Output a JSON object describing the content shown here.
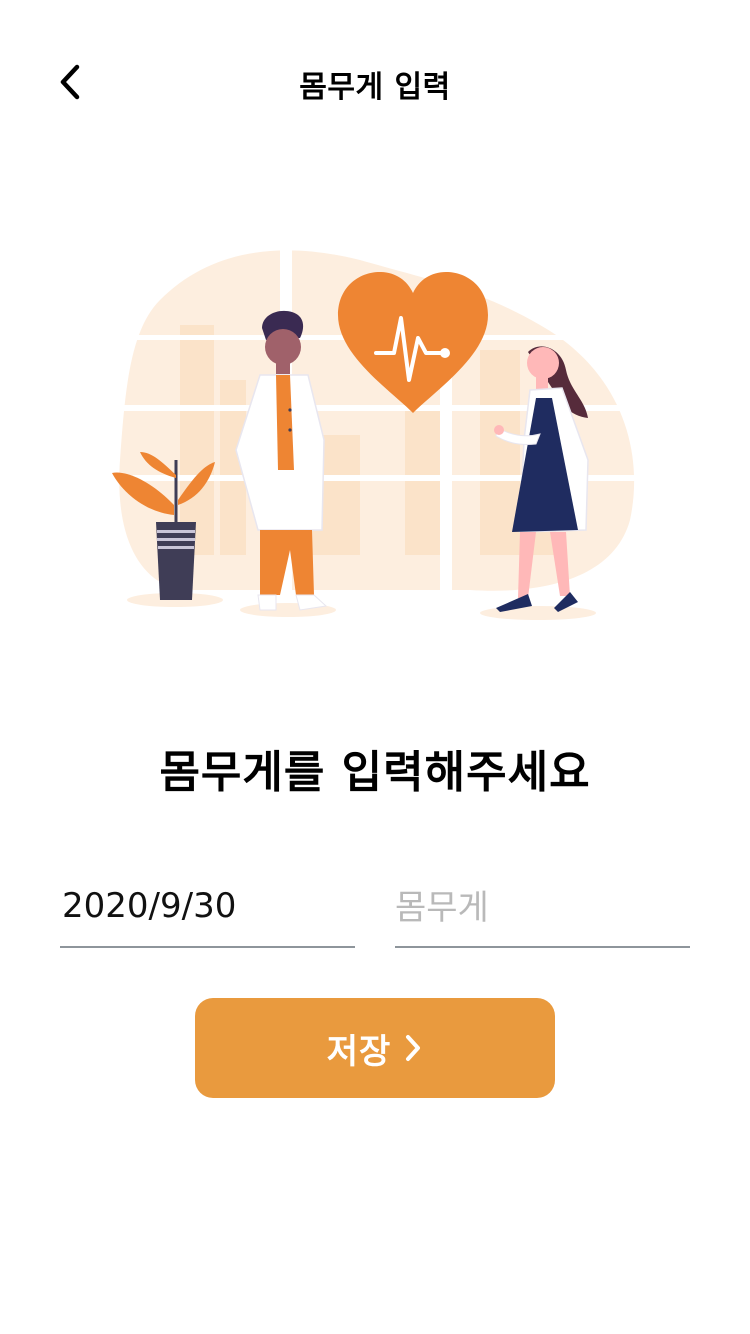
{
  "header": {
    "title": "몸무게 입력",
    "back_icon": "chevron-left-icon"
  },
  "illustration": {
    "icon": "heart-pulse-icon",
    "colors": {
      "accent": "#ee8533",
      "background_shape": "#fdeedf",
      "pants": "#ef8d32",
      "skirt": "#1f2c60",
      "pot": "#3f3d56"
    }
  },
  "main": {
    "heading": "몸무게를 입력해주세요"
  },
  "form": {
    "date_value": "2020/9/30",
    "weight_placeholder": "몸무게",
    "weight_value": ""
  },
  "save_button": {
    "label": "저장",
    "icon": "chevron-right-icon",
    "color": "#e99a3e"
  }
}
